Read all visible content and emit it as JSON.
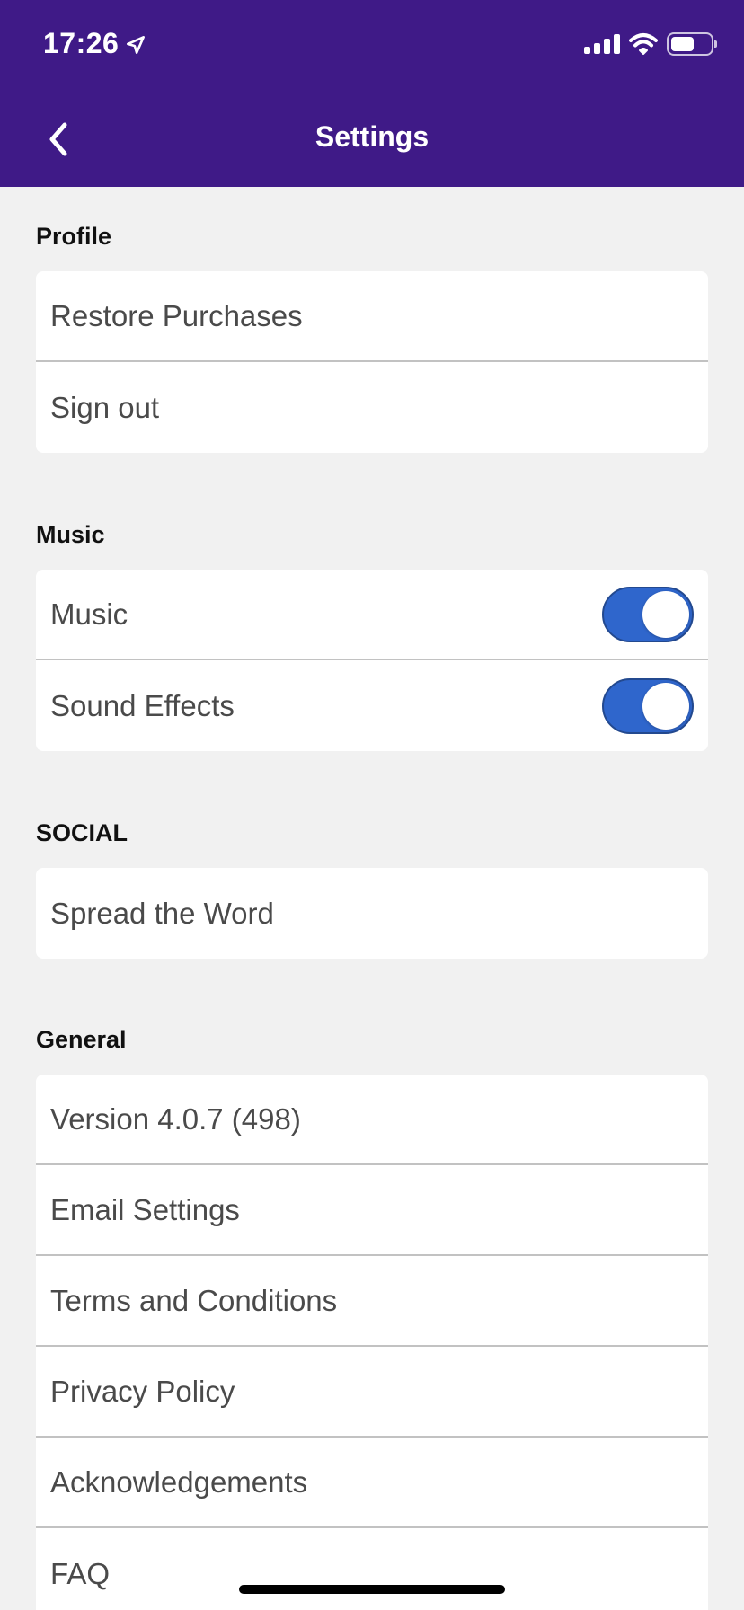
{
  "status_bar": {
    "time": "17:26"
  },
  "header": {
    "title": "Settings",
    "background": "#3f1a87"
  },
  "sections": {
    "profile": {
      "title": "Profile",
      "items": [
        "Restore Purchases",
        "Sign out"
      ]
    },
    "music": {
      "title": "Music",
      "items": [
        {
          "label": "Music",
          "enabled": true
        },
        {
          "label": "Sound Effects",
          "enabled": true
        }
      ]
    },
    "social": {
      "title": "SOCIAL",
      "items": [
        "Spread the Word"
      ]
    },
    "general": {
      "title": "General",
      "items": [
        "Version 4.0.7 (498)",
        "Email Settings",
        "Terms and Conditions",
        "Privacy Policy",
        "Acknowledgements",
        "FAQ"
      ]
    }
  },
  "colors": {
    "toggle_on": "#2f66cc",
    "page_background": "#f1f1f1"
  }
}
